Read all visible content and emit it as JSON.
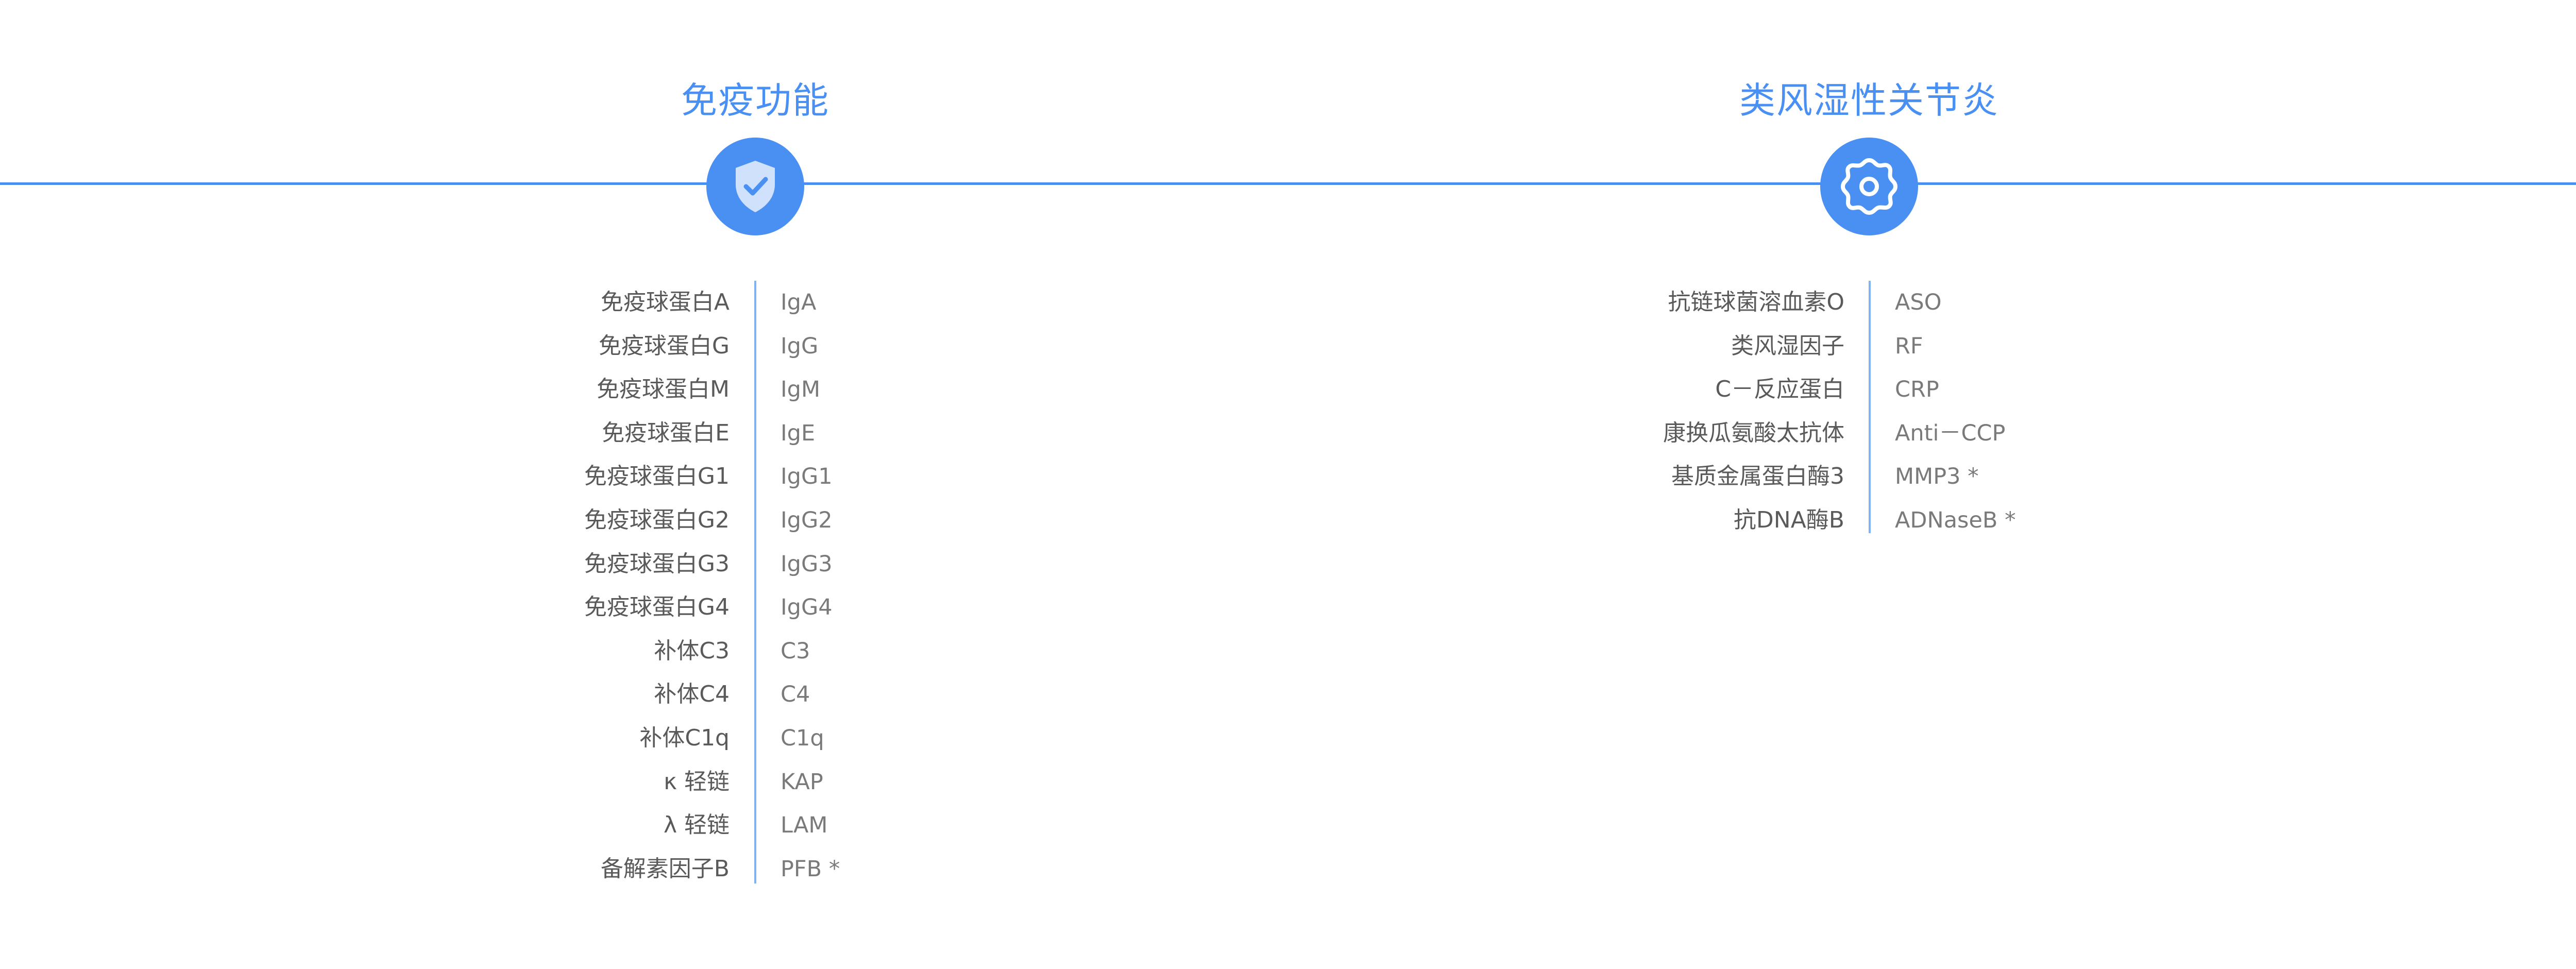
{
  "colors": {
    "accent": "#4a90f2",
    "line": "#4a8ff0",
    "divider": "#7fb3f4",
    "label_text": "#5a5a5a",
    "abbr_text": "#7a7a7a",
    "background": "#ffffff"
  },
  "sections": [
    {
      "title": "免疫功能",
      "icon": "shield-check-icon",
      "items": [
        {
          "name": "免疫球蛋白A",
          "abbr": "IgA"
        },
        {
          "name": "免疫球蛋白G",
          "abbr": "IgG"
        },
        {
          "name": "免疫球蛋白M",
          "abbr": "IgM"
        },
        {
          "name": "免疫球蛋白E",
          "abbr": "IgE"
        },
        {
          "name": "免疫球蛋白G1",
          "abbr": "IgG1"
        },
        {
          "name": "免疫球蛋白G2",
          "abbr": "IgG2"
        },
        {
          "name": "免疫球蛋白G3",
          "abbr": "IgG3"
        },
        {
          "name": "免疫球蛋白G4",
          "abbr": "IgG4"
        },
        {
          "name": "补体C3",
          "abbr": "C3"
        },
        {
          "name": "补体C4",
          "abbr": "C4"
        },
        {
          "name": "补体C1q",
          "abbr": "C1q"
        },
        {
          "name": "κ 轻链",
          "abbr": "KAP"
        },
        {
          "name": "λ 轻链",
          "abbr": "LAM"
        },
        {
          "name": "备解素因子B",
          "abbr": "PFB *"
        }
      ]
    },
    {
      "title": "类风湿性关节炎",
      "icon": "cell-gear-icon",
      "items": [
        {
          "name": "抗链球菌溶血素O",
          "abbr": "ASO"
        },
        {
          "name": "类风湿因子",
          "abbr": "RF"
        },
        {
          "name": "C－反应蛋白",
          "abbr": "CRP"
        },
        {
          "name": "康换瓜氨酸太抗体",
          "abbr": "Anti－CCP"
        },
        {
          "name": "基质金属蛋白酶3",
          "abbr": "MMP3 *"
        },
        {
          "name": "抗DNA酶B",
          "abbr": "ADNaseB *"
        }
      ]
    }
  ]
}
